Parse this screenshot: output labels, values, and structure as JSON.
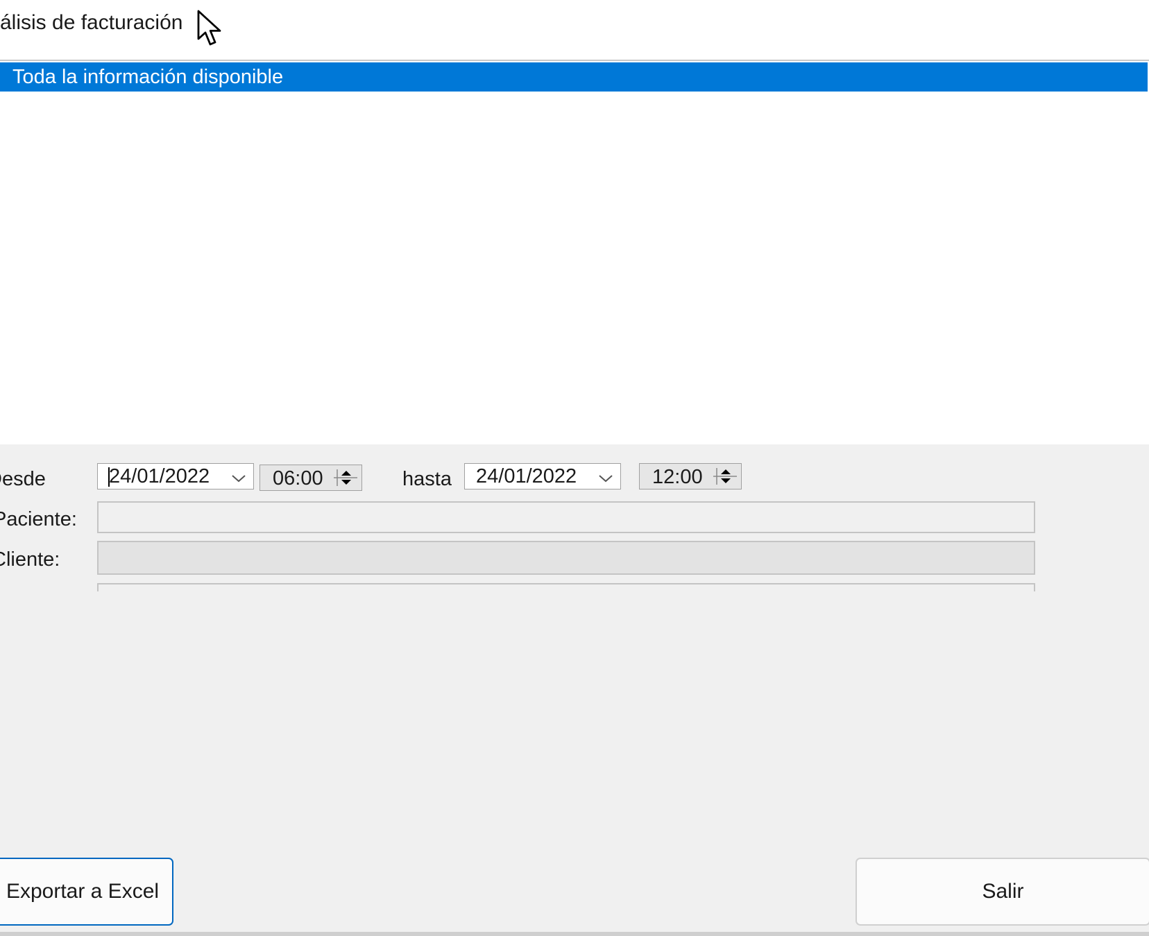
{
  "window": {
    "title": "álisis de facturación"
  },
  "list": {
    "items": [
      {
        "label": "Toda la información disponible",
        "selected": true
      }
    ]
  },
  "form": {
    "desde_label": "Desde",
    "hasta_label": "hasta",
    "paciente_label": "Paciente:",
    "cliente_label": "Cliente:",
    "from_date": "24/01/2022",
    "from_time": "06:00",
    "to_date": "24/01/2022",
    "to_time": "12:00",
    "paciente_value": "",
    "cliente_value": ""
  },
  "buttons": {
    "export_label": "Exportar a Excel",
    "exit_label": "Salir"
  },
  "colors": {
    "selection": "#0078d7",
    "panel_bg": "#f0f0f0",
    "primary_border": "#0067c0"
  }
}
